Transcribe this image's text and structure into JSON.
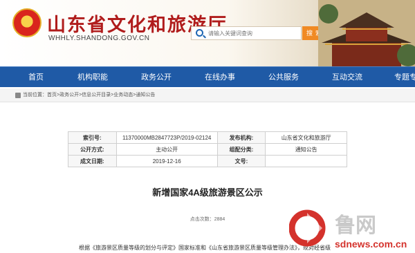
{
  "header": {
    "site_title": "山东省文化和旅游厅",
    "site_url": "WHHLY.SHANDONG.GOV.CN",
    "search_placeholder": "请输入关键词查询",
    "search_button": "搜索"
  },
  "nav": {
    "items": [
      "首页",
      "机构职能",
      "政务公开",
      "在线办事",
      "公共服务",
      "互动交流",
      "专题专栏"
    ]
  },
  "breadcrumb": {
    "text": "当前位置：首页>政务公开>信息公开目录>业务动态>通知公告"
  },
  "info": {
    "index_label": "索引号:",
    "index_value": "11370000MB2847723P/2019-02124",
    "publisher_label": "发布机构:",
    "publisher_value": "山东省文化和旅游厅",
    "mode_label": "公开方式:",
    "mode_value": "主动公开",
    "category_label": "组配分类:",
    "category_value": "通知公告",
    "date_label": "成文日期:",
    "date_value": "2019-12-16",
    "docno_label": "文号:",
    "docno_value": ""
  },
  "article": {
    "title": "新增国家4A级旅游景区公示",
    "views_label": "点击次数：",
    "views_count": "2884",
    "body_start": "根据《旅游景区质量等级的划分与评定》国家标准和《山东省旅游景区质量等级管理办法》，现对经省级"
  },
  "watermark": {
    "brand": "鲁网",
    "url": "sdnews.com.cn"
  },
  "colors": {
    "title_red": "#b01c1c",
    "nav_blue": "#1f5aa6",
    "search_orange": "#f08a24",
    "watermark_red": "#d4322c"
  }
}
